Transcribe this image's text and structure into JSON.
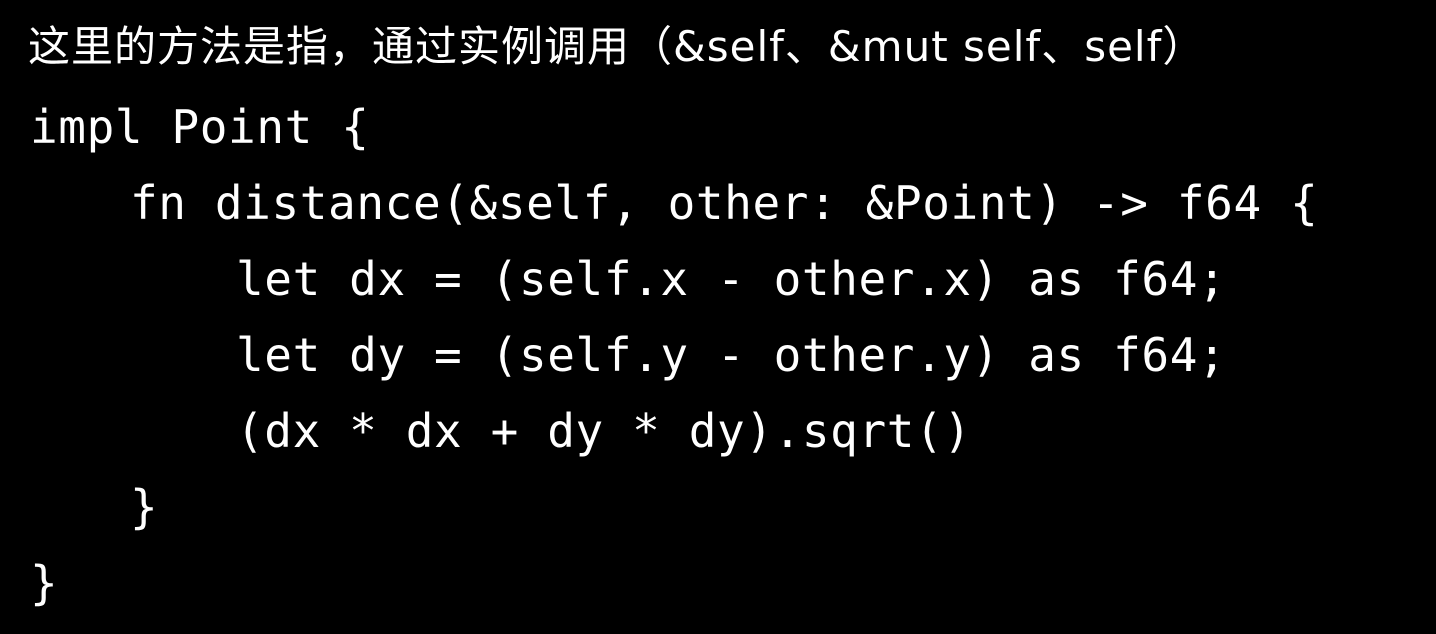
{
  "heading": "这里的方法是指，通过实例调用（&self、&mut self、self）",
  "code": {
    "lines": [
      "impl Point {",
      "fn distance(&self, other: &Point) -> f64 {",
      "let dx = (self.x - other.x) as f64;",
      "let dy = (self.y - other.y) as f64;",
      "(dx * dx + dy * dy).sqrt()",
      "}",
      "}"
    ]
  }
}
